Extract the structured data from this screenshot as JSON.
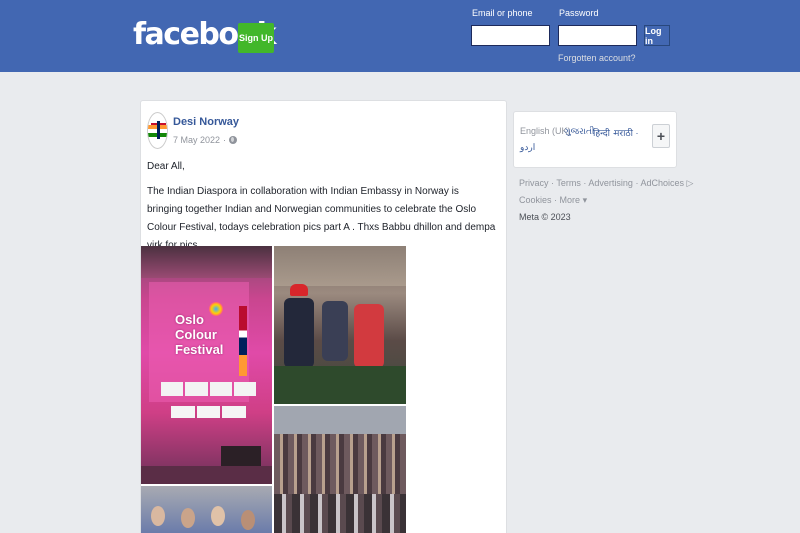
{
  "header": {
    "logo": "facebook",
    "signup_label": "Sign Up",
    "email_label": "Email or phone",
    "password_label": "Password",
    "login_label": "Log in",
    "forgot_label": "Forgotten account?"
  },
  "post": {
    "page_name": "Desi Norway",
    "date": "7 May 2022",
    "privacy_icon": "globe-icon",
    "greeting": "Dear All,",
    "body": "The Indian Diaspora in collaboration with Indian Embassy in Norway is bringing together Indian and Norwegian communities to celebrate the Oslo Colour Festival, todays celebration pics part A . Thxs Babbu dhillon and dempa virk for pics",
    "stage_sign": "Oslo Colour Festival"
  },
  "sidebar": {
    "languages": {
      "current": "English (UK) ·",
      "options": [
        "ગુજરાતી ·",
        "हिन्दी ·",
        "मराठी ·",
        "اردو"
      ]
    },
    "footer": {
      "line1": [
        "Privacy",
        "·",
        "Terms",
        "·",
        "Advertising",
        "·",
        "AdChoices"
      ],
      "line2": [
        "Cookies",
        "·",
        "More"
      ],
      "copyright": "Meta © 2023"
    }
  },
  "colors": {
    "brand_blue": "#4267b2",
    "signup_green": "#42b72a",
    "link_blue": "#365899",
    "background": "#e9ebee"
  }
}
